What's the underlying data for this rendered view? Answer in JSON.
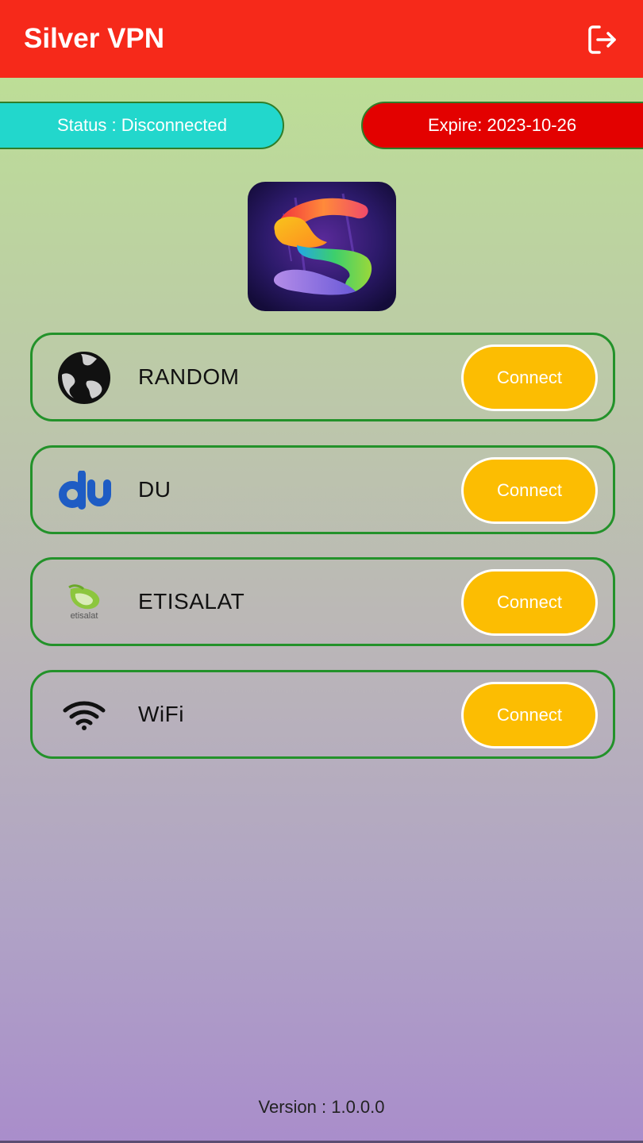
{
  "header": {
    "title": "Silver VPN",
    "logout_icon": "logout-icon"
  },
  "status": {
    "text": "Status : Disconnected",
    "color": "#22d7cc"
  },
  "expire": {
    "text": "Expire: 2023-10-26",
    "color": "#e30100"
  },
  "app_logo_icon": "rainbow-s-logo",
  "servers": [
    {
      "name": "RANDOM",
      "icon": "globe-icon",
      "button_label": "Connect"
    },
    {
      "name": "DU",
      "icon": "du-logo",
      "button_label": "Connect"
    },
    {
      "name": "ETISALAT",
      "icon": "etisalat-logo",
      "icon_text": "etisalat",
      "button_label": "Connect"
    },
    {
      "name": "WiFi",
      "icon": "wifi-icon",
      "button_label": "Connect"
    }
  ],
  "footer": {
    "version": "Version : 1.0.0.0"
  },
  "colors": {
    "app_bar": "#f6291a",
    "connect_button": "#fcbd02",
    "card_border": "#23922a"
  }
}
